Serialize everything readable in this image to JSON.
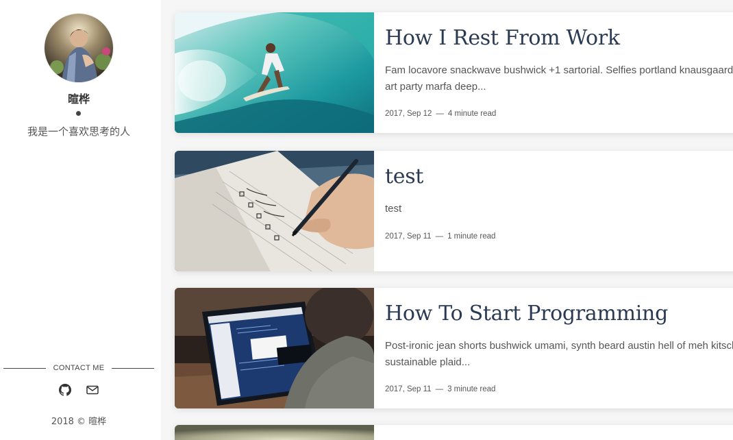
{
  "sidebar": {
    "author_name": "暄桦",
    "author_bio": "我是一个喜欢思考的人",
    "contact_label": "CONTACT ME",
    "social": [
      {
        "icon": "github-icon"
      },
      {
        "icon": "mail-icon"
      }
    ],
    "copyright": "2018 © 暄桦"
  },
  "posts": [
    {
      "title": "How I Rest From Work",
      "excerpt_lines": [
        "Fam locavore snackwave bushwick +1 sartorial. Selfies portland knausgaard",
        "art party marfa deep..."
      ],
      "date": "2017, Sep 12",
      "read_time": "4 minute read",
      "thumbnail": "surfer-wave-photo"
    },
    {
      "title": "test",
      "excerpt_lines": [
        "test"
      ],
      "date": "2017, Sep 11",
      "read_time": "1 minute read",
      "thumbnail": "notebook-writing-photo"
    },
    {
      "title": "How To Start Programming",
      "excerpt_lines": [
        "Post-ironic jean shorts bushwick umami, synth beard austin hell of meh kitsch",
        "sustainable plaid..."
      ],
      "date": "2017, Sep 11",
      "read_time": "3 minute read",
      "thumbnail": "laptop-code-photo"
    }
  ],
  "meta_separator": "—",
  "colors": {
    "title": "#2a3a52",
    "text": "#555555",
    "background": "#f6f6f6"
  }
}
